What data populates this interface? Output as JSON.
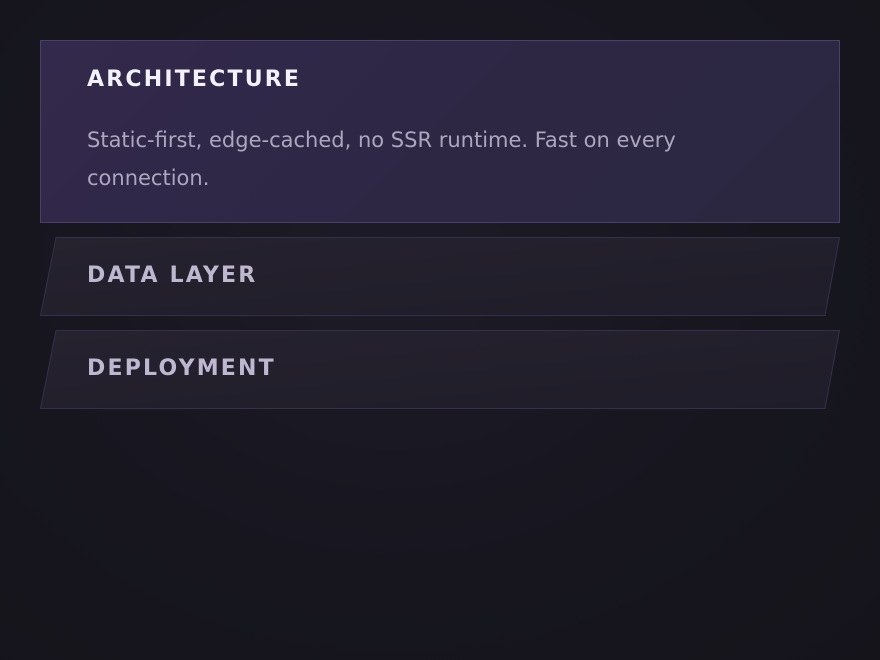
{
  "accordion": {
    "panels": [
      {
        "title": "ARCHITECTURE",
        "body": "Static-first, edge-cached, no SSR runtime. Fast on every connection.",
        "expanded": true
      },
      {
        "title": "DATA LAYER",
        "expanded": false
      },
      {
        "title": "DEPLOYMENT",
        "expanded": false
      }
    ]
  },
  "colors": {
    "background": "#17161f",
    "open_panel_fill": "#2f2746",
    "open_panel_border": "#4a4068",
    "closed_panel_fill": "#221f2e",
    "title_active": "#f3f1fb",
    "title_inactive": "#bdb7cf",
    "body_text": "#aca6bf"
  }
}
